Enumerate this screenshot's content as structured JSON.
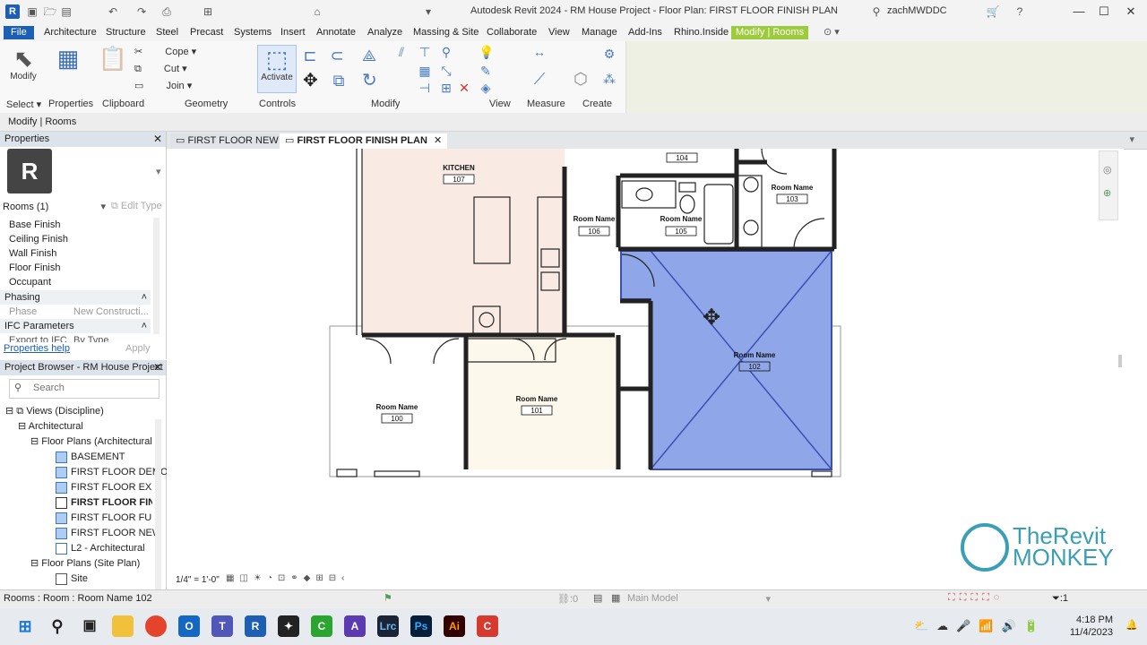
{
  "app": {
    "title": "Autodesk Revit 2024 - RM House Project - Floor Plan: FIRST FLOOR FINISH PLAN",
    "logo_letter": "R",
    "user": "zachMWDDC"
  },
  "menu_tabs": [
    "File",
    "Architecture",
    "Structure",
    "Steel",
    "Precast",
    "Systems",
    "Insert",
    "Annotate",
    "Analyze",
    "Massing & Site",
    "Collaborate",
    "View",
    "Manage",
    "Add-Ins",
    "Rhino.Inside",
    "Modify | Rooms"
  ],
  "ribbon": {
    "modify_label": "Modify",
    "activate_label": "Activate",
    "cope_label": "Cope",
    "cut_label": "Cut",
    "join_label": "Join",
    "panels": [
      "Select",
      "Properties",
      "Clipboard",
      "Geometry",
      "Controls",
      "Modify",
      "View",
      "Measure",
      "Create"
    ]
  },
  "options_bar": {
    "context": "Modify | Rooms"
  },
  "properties": {
    "header": "Properties",
    "type_letter": "R",
    "selector": "Rooms (1)",
    "edit_type": "Edit Type",
    "rows": [
      "Base Finish",
      "Ceiling Finish",
      "Wall Finish",
      "Floor Finish",
      "Occupant"
    ],
    "phasing_group": "Phasing",
    "phase_key": "Phase",
    "phase_value": "New Constructi...",
    "ifc_group": "IFC Parameters",
    "export_key": "Export to IFC",
    "export_value": "By Type",
    "help_link": "Properties help",
    "apply": "Apply"
  },
  "browser": {
    "header": "Project Browser - RM House Project",
    "search_placeholder": "Search",
    "items": [
      "Views (Discipline)",
      "Architectural",
      "Floor Plans (Architectural Pl",
      "BASEMENT",
      "FIRST FLOOR DEMO",
      "FIRST FLOOR EXISTIN",
      "FIRST FLOOR FINISI",
      "FIRST FLOOR FURNIT",
      "FIRST FLOOR NEW",
      "L2 - Architectural",
      "Floor Plans (Site Plan)",
      "Site"
    ]
  },
  "view_tabs": [
    "FIRST FLOOR NEW",
    "FIRST FLOOR FINISH PLAN"
  ],
  "plan": {
    "rooms": [
      {
        "name": "KITCHEN",
        "number": "107"
      },
      {
        "name": "Room Name",
        "number": "106"
      },
      {
        "name": "Room Name",
        "number": "105"
      },
      {
        "name": "",
        "number": "104"
      },
      {
        "name": "Room Name",
        "number": "103"
      },
      {
        "name": "Room Name",
        "number": "102"
      },
      {
        "name": "Room Name",
        "number": "101"
      },
      {
        "name": "Room Name",
        "number": "100"
      }
    ]
  },
  "view_control": {
    "scale": "1/4\" = 1'-0\""
  },
  "status": {
    "selection": "Rooms : Room : Room Name 102",
    "model": "Main Model",
    "worksets": ":0",
    "filter": ":1"
  },
  "watermark": {
    "line1": "TheRevit",
    "line2": "MONKEY"
  },
  "taskbar": {
    "time": "4:18 PM",
    "date": "11/4/2023"
  },
  "colors": {
    "accent": "#1c5fb5",
    "context_tab": "#9ccc3c",
    "selected_room": "#8fa6e8"
  }
}
